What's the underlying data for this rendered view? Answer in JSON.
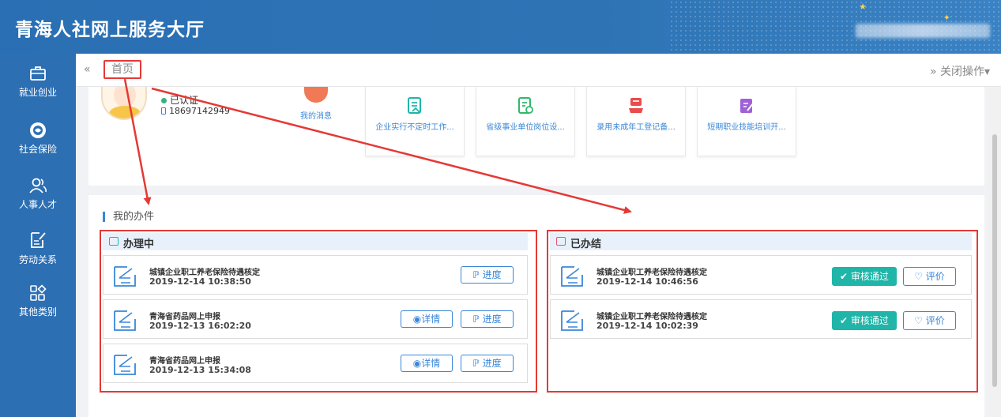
{
  "header": {
    "title": "青海人社网上服务大厅"
  },
  "sidebar": {
    "items": [
      {
        "label": "就业创业",
        "icon": "briefcase-icon"
      },
      {
        "label": "社会保险",
        "icon": "insurance-logo-icon"
      },
      {
        "label": "人事人才",
        "icon": "people-icon"
      },
      {
        "label": "劳动关系",
        "icon": "document-edit-icon"
      },
      {
        "label": "其他类别",
        "icon": "grid-diamond-icon"
      }
    ]
  },
  "tabs": {
    "prev": "«",
    "home": "首页",
    "close_ops": "» 关闭操作▾"
  },
  "profile": {
    "verified": "已认证",
    "phone": "18697142949",
    "messages": "我的消息"
  },
  "services": [
    {
      "label": "企业实行不定时工作...",
      "icon": "form-icon"
    },
    {
      "label": "省级事业单位岗位设...",
      "icon": "checklist-icon"
    },
    {
      "label": "录用未成年工登记备...",
      "icon": "registration-icon"
    },
    {
      "label": "短期职业技能培训开...",
      "icon": "edit-icon"
    }
  ],
  "my_tasks": {
    "title": "我的办件",
    "in_progress": {
      "title": "办理中",
      "items": [
        {
          "name": "城镇企业职工养老保险待遇核定",
          "time": "2019-12-14 10:38:50",
          "detail": "",
          "progress": "进度"
        },
        {
          "name": "青海省药品网上申报",
          "time": "2019-12-13 16:02:20",
          "detail": "详情",
          "progress": "进度"
        },
        {
          "name": "青海省药品网上申报",
          "time": "2019-12-13 15:34:08",
          "detail": "详情",
          "progress": "进度"
        }
      ]
    },
    "done": {
      "title": "已办结",
      "items": [
        {
          "name": "城镇企业职工养老保险待遇核定",
          "time": "2019-12-14 10:46:56",
          "status": "审核通过",
          "rate": "评价"
        },
        {
          "name": "城镇企业职工养老保险待遇核定",
          "time": "2019-12-14 10:02:39",
          "status": "审核通过",
          "rate": "评价"
        }
      ]
    }
  },
  "colors": {
    "primary": "#2d6fb3",
    "accent": "#3a87d8",
    "annotation": "#e53935",
    "approve": "#1fb5a8"
  }
}
